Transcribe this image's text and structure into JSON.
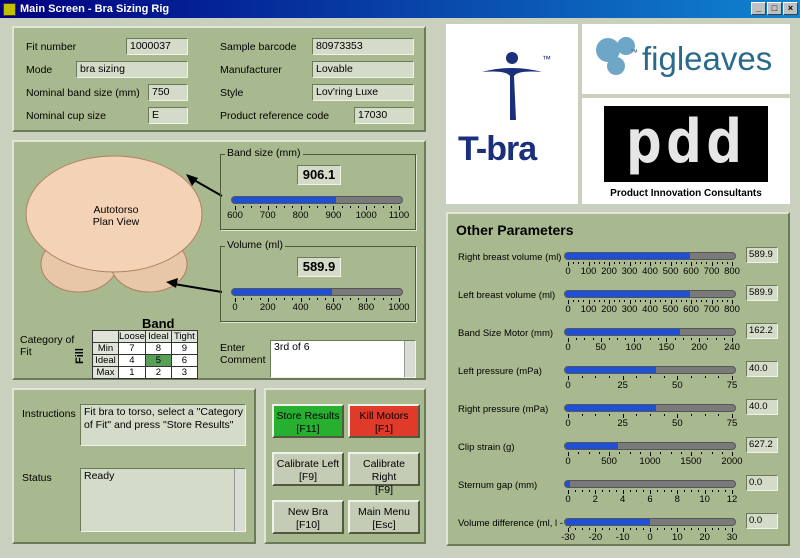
{
  "window": {
    "title": "Main Screen - Bra Sizing Rig"
  },
  "fit_info": {
    "fit_number": {
      "label": "Fit number",
      "value": "1000037"
    },
    "mode": {
      "label": "Mode",
      "value": "bra sizing"
    },
    "nominal_band": {
      "label": "Nominal band size (mm)",
      "value": "750"
    },
    "nominal_cup": {
      "label": "Nominal cup size",
      "value": "E"
    },
    "sample_barcode": {
      "label": "Sample barcode",
      "value": "80973353"
    },
    "manufacturer": {
      "label": "Manufacturer",
      "value": "Lovable"
    },
    "style": {
      "label": "Style",
      "value": "Lov'ring Luxe"
    },
    "product_ref": {
      "label": "Product reference code",
      "value": "17030"
    }
  },
  "torso": {
    "label": "Autotorso\nPlan View",
    "band_size": {
      "title": "Band size (mm)",
      "value": "906.1",
      "numeric": 906.1,
      "min": 600,
      "max": 1100,
      "ticks": [
        "600",
        "700",
        "800",
        "900",
        "1000",
        "1100"
      ]
    },
    "volume": {
      "title": "Volume (ml)",
      "value": "589.9",
      "numeric": 589.9,
      "min": 0,
      "max": 1000,
      "ticks": [
        "0",
        "200",
        "400",
        "600",
        "800",
        "1000"
      ]
    },
    "category": {
      "label": "Category of Fit",
      "band_label": "Band",
      "fill_label": "Fill",
      "columns": [
        "Loose",
        "Ideal",
        "Tight"
      ],
      "rows": [
        {
          "name": "Min",
          "cells": [
            "7",
            "8",
            "9"
          ]
        },
        {
          "name": "Ideal",
          "cells": [
            "4",
            "5",
            "6"
          ]
        },
        {
          "name": "Max",
          "cells": [
            "1",
            "2",
            "3"
          ]
        }
      ]
    },
    "comment": {
      "label": "Enter Comment",
      "value": "3rd of 6"
    }
  },
  "status_panel": {
    "instructions_label": "Instructions",
    "instructions": "Fit bra to torso, select a \"Category of Fit\" and press \"Store Results\"",
    "status_label": "Status",
    "status": "Ready"
  },
  "buttons": {
    "store": "Store Results\n[F11]",
    "kill": "Kill Motors\n[F1]",
    "cal_left": "Calibrate Left\n[F9]",
    "cal_right": "Calibrate Right\n[F9]",
    "new_bra": "New Bra\n[F10]",
    "main_menu": "Main Menu\n[Esc]"
  },
  "logos": {
    "tbra": "T-bra",
    "tm": "™",
    "figleaves": "figleaves",
    "pdd_caption": "Product Innovation Consultants",
    "pdd": "pdd"
  },
  "other": {
    "title": "Other Parameters",
    "params": [
      {
        "label": "Right breast volume (ml)",
        "value": "589.9",
        "numeric": 589.9,
        "min": 0,
        "max": 800,
        "ticks": [
          "0",
          "100",
          "200",
          "300",
          "400",
          "500",
          "600",
          "700",
          "800"
        ]
      },
      {
        "label": "Left breast volume (ml)",
        "value": "589.9",
        "numeric": 589.9,
        "min": 0,
        "max": 800,
        "ticks": [
          "0",
          "100",
          "200",
          "300",
          "400",
          "500",
          "600",
          "700",
          "800"
        ]
      },
      {
        "label": "Band Size Motor (mm)",
        "value": "162.2",
        "numeric": 162.2,
        "min": 0,
        "max": 240,
        "ticks": [
          "0",
          "50",
          "100",
          "150",
          "200",
          "240"
        ]
      },
      {
        "label": "Left pressure (mPa)",
        "value": "40.0",
        "numeric": 40.0,
        "min": 0,
        "max": 75,
        "ticks": [
          "0",
          "25",
          "50",
          "75"
        ]
      },
      {
        "label": "Right pressure (mPa)",
        "value": "40.0",
        "numeric": 40.0,
        "min": 0,
        "max": 75,
        "ticks": [
          "0",
          "25",
          "50",
          "75"
        ]
      },
      {
        "label": "Clip strain (g)",
        "value": "627.2",
        "numeric": 627.2,
        "min": 0,
        "max": 2000,
        "ticks": [
          "0",
          "500",
          "1000",
          "1500",
          "2000"
        ]
      },
      {
        "label": "Sternum gap (mm)",
        "value": "0.0",
        "numeric": 0.0,
        "min": 0,
        "max": 12,
        "ticks": [
          "0",
          "2",
          "4",
          "6",
          "8",
          "10",
          "12"
        ]
      },
      {
        "label": "Volume difference (ml, l - r)",
        "value": "0.0",
        "numeric": 0.0,
        "min": -30,
        "max": 30,
        "ticks": [
          "-30",
          "-20",
          "-10",
          "0",
          "10",
          "20",
          "30"
        ]
      }
    ]
  }
}
